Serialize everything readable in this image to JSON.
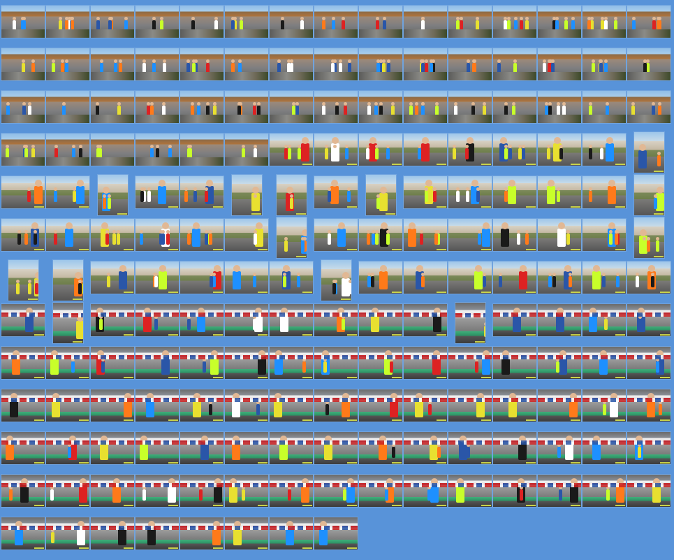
{
  "gallery": {
    "title": "",
    "background": "#5893d9",
    "rows": [
      {
        "count": 15,
        "scene": "street"
      },
      {
        "count": 15,
        "scene": "street"
      },
      {
        "count": 15,
        "scene": "street"
      },
      {
        "count": 15,
        "scene": "mixed-street-town"
      },
      {
        "count": 15,
        "scene": "town"
      },
      {
        "count": 15,
        "scene": "town"
      },
      {
        "count": 15,
        "scene": "town"
      },
      {
        "count": 15,
        "scene": "finish"
      },
      {
        "count": 15,
        "scene": "finish"
      },
      {
        "count": 15,
        "scene": "finish"
      },
      {
        "count": 15,
        "scene": "finish"
      },
      {
        "count": 15,
        "scene": "finish"
      },
      {
        "count": 8,
        "scene": "finish"
      }
    ],
    "jersey_colors": [
      "#1e90ff",
      "#ff7a1a",
      "#c8ff2a",
      "#ffffff",
      "#1a1a1a",
      "#d22",
      "#e8e030",
      "#2a56a8"
    ]
  }
}
